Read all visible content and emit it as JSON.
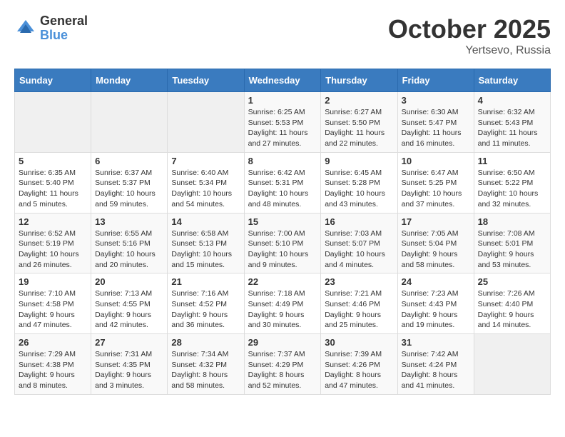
{
  "logo": {
    "general": "General",
    "blue": "Blue"
  },
  "header": {
    "month": "October 2025",
    "location": "Yertsevo, Russia"
  },
  "weekdays": [
    "Sunday",
    "Monday",
    "Tuesday",
    "Wednesday",
    "Thursday",
    "Friday",
    "Saturday"
  ],
  "weeks": [
    [
      {
        "day": "",
        "info": ""
      },
      {
        "day": "",
        "info": ""
      },
      {
        "day": "",
        "info": ""
      },
      {
        "day": "1",
        "info": "Sunrise: 6:25 AM\nSunset: 5:53 PM\nDaylight: 11 hours\nand 27 minutes."
      },
      {
        "day": "2",
        "info": "Sunrise: 6:27 AM\nSunset: 5:50 PM\nDaylight: 11 hours\nand 22 minutes."
      },
      {
        "day": "3",
        "info": "Sunrise: 6:30 AM\nSunset: 5:47 PM\nDaylight: 11 hours\nand 16 minutes."
      },
      {
        "day": "4",
        "info": "Sunrise: 6:32 AM\nSunset: 5:43 PM\nDaylight: 11 hours\nand 11 minutes."
      }
    ],
    [
      {
        "day": "5",
        "info": "Sunrise: 6:35 AM\nSunset: 5:40 PM\nDaylight: 11 hours\nand 5 minutes."
      },
      {
        "day": "6",
        "info": "Sunrise: 6:37 AM\nSunset: 5:37 PM\nDaylight: 10 hours\nand 59 minutes."
      },
      {
        "day": "7",
        "info": "Sunrise: 6:40 AM\nSunset: 5:34 PM\nDaylight: 10 hours\nand 54 minutes."
      },
      {
        "day": "8",
        "info": "Sunrise: 6:42 AM\nSunset: 5:31 PM\nDaylight: 10 hours\nand 48 minutes."
      },
      {
        "day": "9",
        "info": "Sunrise: 6:45 AM\nSunset: 5:28 PM\nDaylight: 10 hours\nand 43 minutes."
      },
      {
        "day": "10",
        "info": "Sunrise: 6:47 AM\nSunset: 5:25 PM\nDaylight: 10 hours\nand 37 minutes."
      },
      {
        "day": "11",
        "info": "Sunrise: 6:50 AM\nSunset: 5:22 PM\nDaylight: 10 hours\nand 32 minutes."
      }
    ],
    [
      {
        "day": "12",
        "info": "Sunrise: 6:52 AM\nSunset: 5:19 PM\nDaylight: 10 hours\nand 26 minutes."
      },
      {
        "day": "13",
        "info": "Sunrise: 6:55 AM\nSunset: 5:16 PM\nDaylight: 10 hours\nand 20 minutes."
      },
      {
        "day": "14",
        "info": "Sunrise: 6:58 AM\nSunset: 5:13 PM\nDaylight: 10 hours\nand 15 minutes."
      },
      {
        "day": "15",
        "info": "Sunrise: 7:00 AM\nSunset: 5:10 PM\nDaylight: 10 hours\nand 9 minutes."
      },
      {
        "day": "16",
        "info": "Sunrise: 7:03 AM\nSunset: 5:07 PM\nDaylight: 10 hours\nand 4 minutes."
      },
      {
        "day": "17",
        "info": "Sunrise: 7:05 AM\nSunset: 5:04 PM\nDaylight: 9 hours\nand 58 minutes."
      },
      {
        "day": "18",
        "info": "Sunrise: 7:08 AM\nSunset: 5:01 PM\nDaylight: 9 hours\nand 53 minutes."
      }
    ],
    [
      {
        "day": "19",
        "info": "Sunrise: 7:10 AM\nSunset: 4:58 PM\nDaylight: 9 hours\nand 47 minutes."
      },
      {
        "day": "20",
        "info": "Sunrise: 7:13 AM\nSunset: 4:55 PM\nDaylight: 9 hours\nand 42 minutes."
      },
      {
        "day": "21",
        "info": "Sunrise: 7:16 AM\nSunset: 4:52 PM\nDaylight: 9 hours\nand 36 minutes."
      },
      {
        "day": "22",
        "info": "Sunrise: 7:18 AM\nSunset: 4:49 PM\nDaylight: 9 hours\nand 30 minutes."
      },
      {
        "day": "23",
        "info": "Sunrise: 7:21 AM\nSunset: 4:46 PM\nDaylight: 9 hours\nand 25 minutes."
      },
      {
        "day": "24",
        "info": "Sunrise: 7:23 AM\nSunset: 4:43 PM\nDaylight: 9 hours\nand 19 minutes."
      },
      {
        "day": "25",
        "info": "Sunrise: 7:26 AM\nSunset: 4:40 PM\nDaylight: 9 hours\nand 14 minutes."
      }
    ],
    [
      {
        "day": "26",
        "info": "Sunrise: 7:29 AM\nSunset: 4:38 PM\nDaylight: 9 hours\nand 8 minutes."
      },
      {
        "day": "27",
        "info": "Sunrise: 7:31 AM\nSunset: 4:35 PM\nDaylight: 9 hours\nand 3 minutes."
      },
      {
        "day": "28",
        "info": "Sunrise: 7:34 AM\nSunset: 4:32 PM\nDaylight: 8 hours\nand 58 minutes."
      },
      {
        "day": "29",
        "info": "Sunrise: 7:37 AM\nSunset: 4:29 PM\nDaylight: 8 hours\nand 52 minutes."
      },
      {
        "day": "30",
        "info": "Sunrise: 7:39 AM\nSunset: 4:26 PM\nDaylight: 8 hours\nand 47 minutes."
      },
      {
        "day": "31",
        "info": "Sunrise: 7:42 AM\nSunset: 4:24 PM\nDaylight: 8 hours\nand 41 minutes."
      },
      {
        "day": "",
        "info": ""
      }
    ]
  ]
}
